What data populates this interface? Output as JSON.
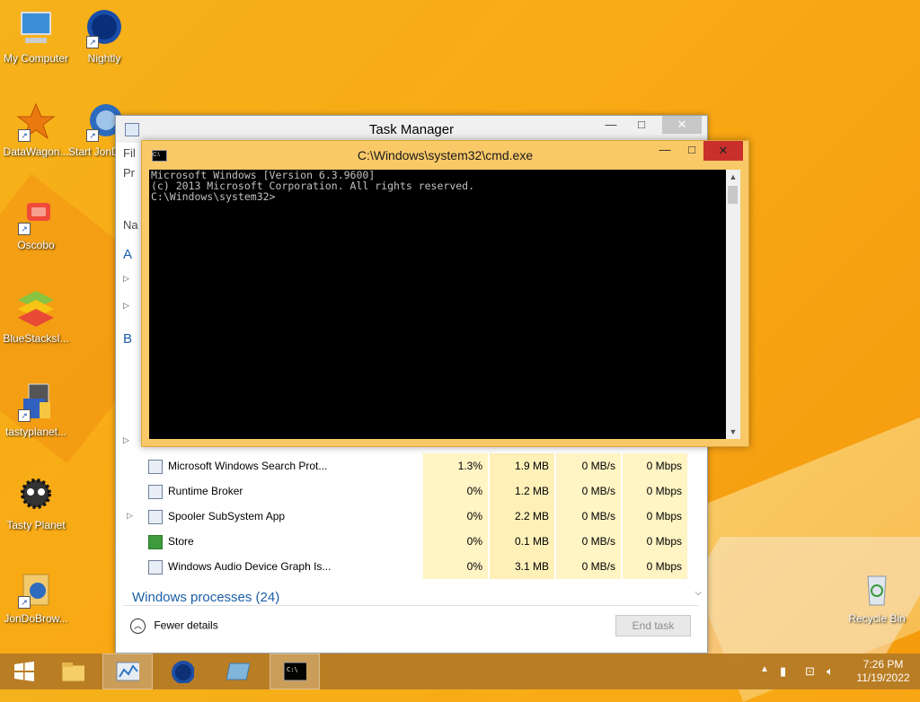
{
  "desktop_icons": [
    {
      "label": "My Computer",
      "icon": "computer-icon"
    },
    {
      "label": "Nightly",
      "icon": "browser-globe-icon"
    },
    {
      "label": "DataWagon...",
      "icon": "datawagon-icon"
    },
    {
      "label": "Start JonDoBr...",
      "icon": "jondo-start-icon"
    },
    {
      "label": "Oscobo",
      "icon": "oscobo-icon"
    },
    {
      "label": "BlueStacksI...",
      "icon": "bluestacks-icon"
    },
    {
      "label": "tastyplanet...",
      "icon": "installer-icon"
    },
    {
      "label": "Tasty Planet",
      "icon": "tasty-planet-icon"
    },
    {
      "label": "JonDoBrow...",
      "icon": "jondo-folder-icon"
    },
    {
      "label": "Recycle Bin",
      "icon": "recycle-bin-icon"
    }
  ],
  "task_manager": {
    "title": "Task Manager",
    "side_labels": [
      "Fil",
      "Pr",
      "Na",
      "A",
      "B"
    ],
    "rows": [
      {
        "name": "Microsoft Windows Search Prot...",
        "cpu": "1.3%",
        "memory": "1.9 MB",
        "disk": "0 MB/s",
        "network": "0 Mbps",
        "expandable": false
      },
      {
        "name": "Runtime Broker",
        "cpu": "0%",
        "memory": "1.2 MB",
        "disk": "0 MB/s",
        "network": "0 Mbps",
        "expandable": false
      },
      {
        "name": "Spooler SubSystem App",
        "cpu": "0%",
        "memory": "2.2 MB",
        "disk": "0 MB/s",
        "network": "0 Mbps",
        "expandable": true
      },
      {
        "name": "Store",
        "cpu": "0%",
        "memory": "0.1 MB",
        "disk": "0 MB/s",
        "network": "0 Mbps",
        "expandable": false
      },
      {
        "name": "Windows Audio Device Graph Is...",
        "cpu": "0%",
        "memory": "3.1 MB",
        "disk": "0 MB/s",
        "network": "0 Mbps",
        "expandable": false
      }
    ],
    "group_label": "Windows processes (24)",
    "fewer_details": "Fewer details",
    "end_task": "End task"
  },
  "cmd": {
    "title": "C:\\Windows\\system32\\cmd.exe",
    "lines": [
      "Microsoft Windows [Version 6.3.9600]",
      "(c) 2013 Microsoft Corporation. All rights reserved.",
      "C:\\Windows\\system32>"
    ]
  },
  "taskbar": {
    "apps": [
      {
        "name": "file-explorer",
        "icon": "folder-icon",
        "active": false
      },
      {
        "name": "task-manager",
        "icon": "task-manager-icon",
        "active": true
      },
      {
        "name": "nightly",
        "icon": "browser-globe-icon",
        "active": false
      },
      {
        "name": "unknown-app",
        "icon": "window-icon",
        "active": false
      },
      {
        "name": "cmd",
        "icon": "cmd-icon",
        "active": true
      }
    ],
    "time": "7:26 PM",
    "date": "11/19/2022"
  }
}
